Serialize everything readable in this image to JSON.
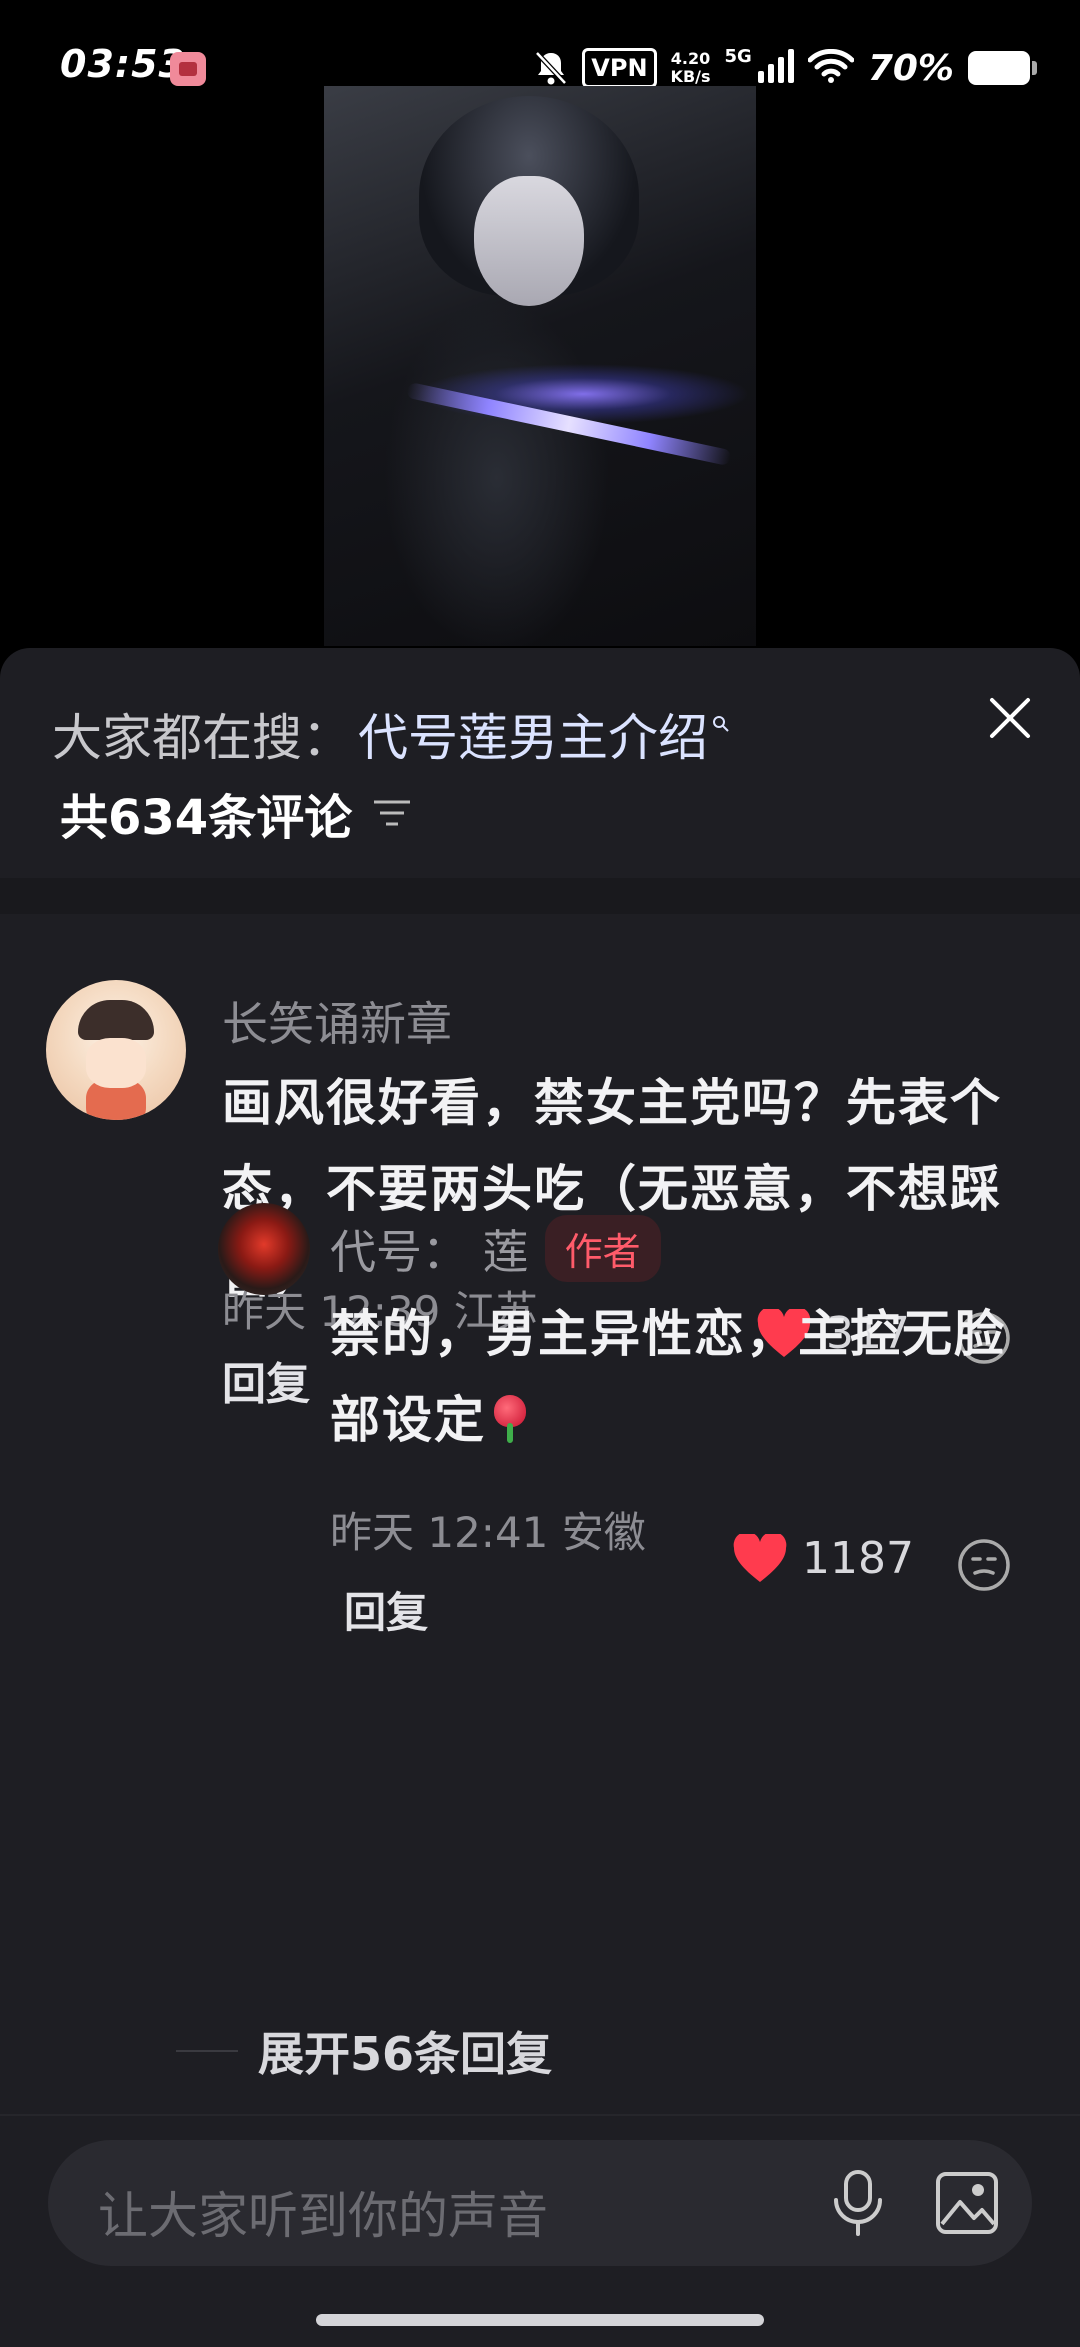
{
  "status_bar": {
    "time": "03:53",
    "vpn": "VPN",
    "net_speed_value": "4.20",
    "net_speed_unit": "KB/s",
    "signal": "5G",
    "battery": "70%"
  },
  "sheet": {
    "search_prefix": "大家都在搜：",
    "search_term": "代号莲男主介绍",
    "comment_count": "共634条评论"
  },
  "comment": {
    "username": "长笑诵新章",
    "text": "画风很好看，禁女主党吗？先表个态，不要两头吃（无恶意，不想踩雷）",
    "meta": "昨天 12:39 江苏",
    "reply_label": "回复",
    "likes": "317"
  },
  "reply": {
    "username": "代号： 莲",
    "author_badge": "作者",
    "text": "禁的，男主异性恋，主控无脸部设定",
    "meta": "昨天 12:41 安徽",
    "reply_label": "回复",
    "likes": "1187"
  },
  "expand_replies": "展开56条回复",
  "input": {
    "placeholder": "让大家听到你的声音"
  },
  "colors": {
    "like_red": "#ff3b4e",
    "sheet_bg": "#1e1e23",
    "badge_text": "#ff5b6a"
  }
}
